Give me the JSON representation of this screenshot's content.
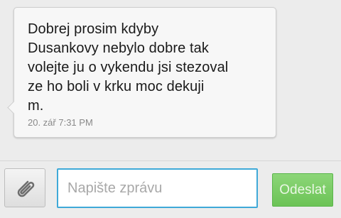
{
  "conversation": {
    "message": {
      "text": "Dobrej prosim kdyby\nDusankovy nebylo dobre tak\nvolejte ju o vykendu jsi stezoval\nze ho boli v krku moc dekuji\nm.",
      "timestamp": "20. zář 7:31 PM"
    }
  },
  "compose": {
    "attach_icon": "paperclip-icon",
    "input_value": "",
    "input_placeholder": "Napište zprávu",
    "send_label": "Odeslat"
  },
  "colors": {
    "input_border": "#3fa9d8",
    "send_button": "#7ccd68",
    "background": "#ececec"
  }
}
